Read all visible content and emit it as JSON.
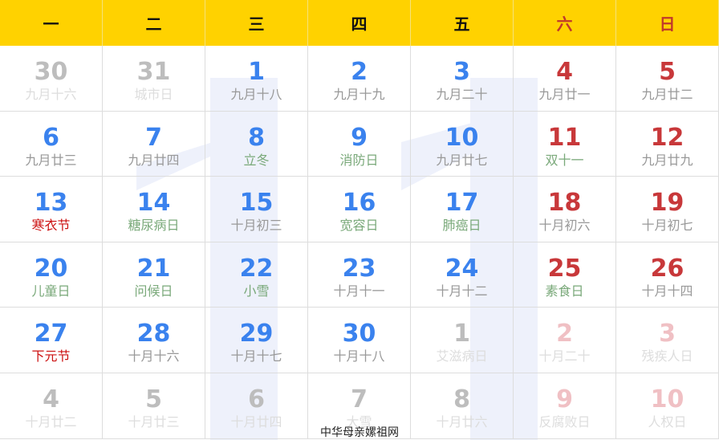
{
  "weekdays": [
    "一",
    "二",
    "三",
    "四",
    "五",
    "六",
    "日"
  ],
  "days": [
    {
      "n": "30",
      "s": "九月十六",
      "c": "other"
    },
    {
      "n": "31",
      "s": "城市日",
      "c": "other"
    },
    {
      "n": "1",
      "s": "九月十八",
      "c": "blue"
    },
    {
      "n": "2",
      "s": "九月十九",
      "c": "blue"
    },
    {
      "n": "3",
      "s": "九月二十",
      "c": "blue"
    },
    {
      "n": "4",
      "s": "九月廿一",
      "c": "red"
    },
    {
      "n": "5",
      "s": "九月廿二",
      "c": "red"
    },
    {
      "n": "6",
      "s": "九月廿三",
      "c": "blue"
    },
    {
      "n": "7",
      "s": "九月廿四",
      "c": "blue"
    },
    {
      "n": "8",
      "s": "立冬",
      "c": "blue fest"
    },
    {
      "n": "9",
      "s": "消防日",
      "c": "blue fest"
    },
    {
      "n": "10",
      "s": "九月廿七",
      "c": "blue"
    },
    {
      "n": "11",
      "s": "双十一",
      "c": "red fest"
    },
    {
      "n": "12",
      "s": "九月廿九",
      "c": "red"
    },
    {
      "n": "13",
      "s": "寒衣节",
      "c": "blue hol"
    },
    {
      "n": "14",
      "s": "糖尿病日",
      "c": "blue fest"
    },
    {
      "n": "15",
      "s": "十月初三",
      "c": "blue"
    },
    {
      "n": "16",
      "s": "宽容日",
      "c": "blue fest"
    },
    {
      "n": "17",
      "s": "肺癌日",
      "c": "blue fest"
    },
    {
      "n": "18",
      "s": "十月初六",
      "c": "red"
    },
    {
      "n": "19",
      "s": "十月初七",
      "c": "red"
    },
    {
      "n": "20",
      "s": "儿童日",
      "c": "blue fest"
    },
    {
      "n": "21",
      "s": "问候日",
      "c": "blue fest"
    },
    {
      "n": "22",
      "s": "小雪",
      "c": "blue fest"
    },
    {
      "n": "23",
      "s": "十月十一",
      "c": "blue"
    },
    {
      "n": "24",
      "s": "十月十二",
      "c": "blue"
    },
    {
      "n": "25",
      "s": "素食日",
      "c": "red fest"
    },
    {
      "n": "26",
      "s": "十月十四",
      "c": "red"
    },
    {
      "n": "27",
      "s": "下元节",
      "c": "blue hol"
    },
    {
      "n": "28",
      "s": "十月十六",
      "c": "blue"
    },
    {
      "n": "29",
      "s": "十月十七",
      "c": "blue"
    },
    {
      "n": "30",
      "s": "十月十八",
      "c": "blue"
    },
    {
      "n": "1",
      "s": "艾滋病日",
      "c": "other"
    },
    {
      "n": "2",
      "s": "十月二十",
      "c": "other red"
    },
    {
      "n": "3",
      "s": "残疾人日",
      "c": "other red"
    },
    {
      "n": "4",
      "s": "十月廿二",
      "c": "other"
    },
    {
      "n": "5",
      "s": "十月廿三",
      "c": "other"
    },
    {
      "n": "6",
      "s": "十月廿四",
      "c": "other"
    },
    {
      "n": "7",
      "s": "大雪",
      "c": "other"
    },
    {
      "n": "8",
      "s": "十月廿六",
      "c": "other"
    },
    {
      "n": "9",
      "s": "反腐败日",
      "c": "other red"
    },
    {
      "n": "10",
      "s": "人权日",
      "c": "other red"
    }
  ],
  "footer": "中华母亲嫘祖网"
}
